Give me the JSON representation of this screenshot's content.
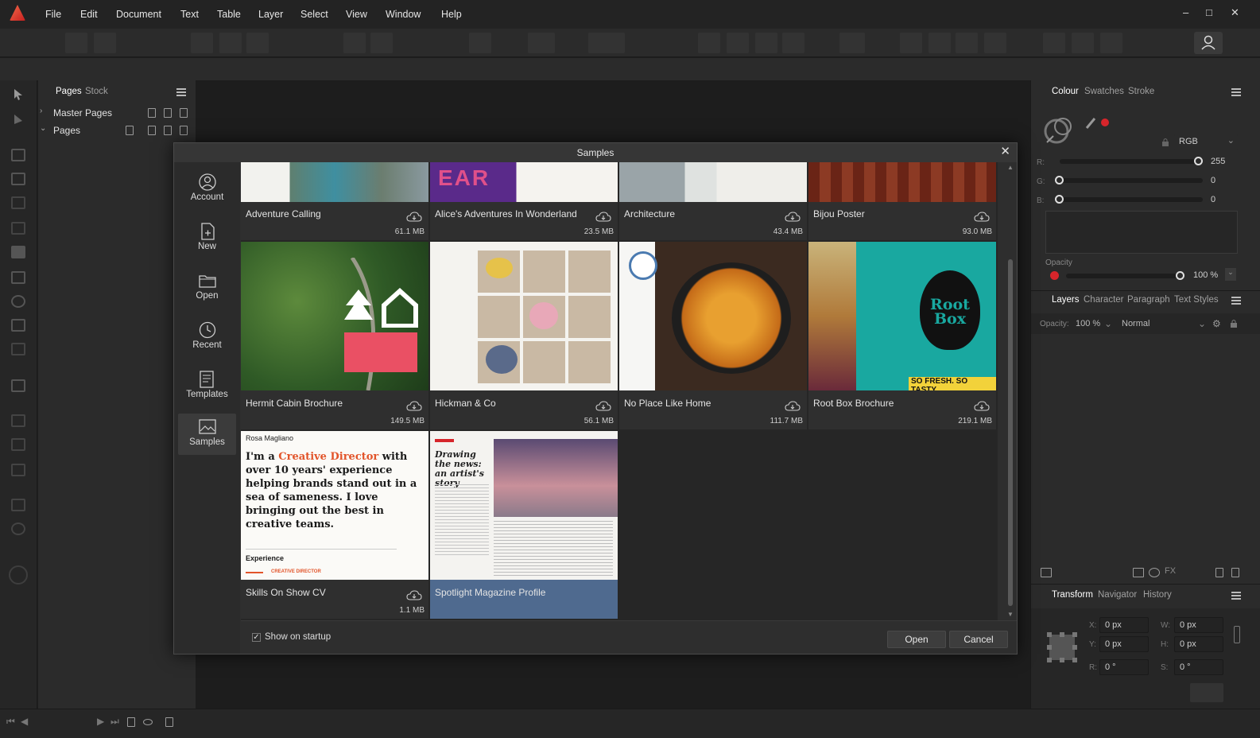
{
  "menu": {
    "items": [
      "File",
      "Edit",
      "Document",
      "Text",
      "Table",
      "Layer",
      "Select",
      "View",
      "Window",
      "Help"
    ]
  },
  "window_controls": {
    "minimize": "–",
    "maximize": "□",
    "close": "✕"
  },
  "pages_panel": {
    "tabs": [
      "Pages",
      "Stock"
    ],
    "rows": [
      "Master Pages",
      "Pages"
    ]
  },
  "right_panel": {
    "colour_tabs": [
      "Colour",
      "Swatches",
      "Stroke"
    ],
    "colour_model": "RGB",
    "channels": [
      {
        "label": "R:",
        "value": "255"
      },
      {
        "label": "G:",
        "value": "0"
      },
      {
        "label": "B:",
        "value": "0"
      }
    ],
    "opacity_label": "Opacity",
    "opacity_value": "100 %",
    "layers_tabs": [
      "Layers",
      "Character",
      "Paragraph",
      "Text Styles"
    ],
    "layers_opacity_label": "Opacity:",
    "layers_opacity_value": "100 %",
    "blend_mode": "Normal",
    "transform_tabs": [
      "Transform",
      "Navigator",
      "History"
    ],
    "transform": {
      "x_label": "X:",
      "x_value": "0 px",
      "y_label": "Y:",
      "y_value": "0 px",
      "w_label": "W:",
      "w_value": "0 px",
      "h_label": "H:",
      "h_value": "0 px",
      "r_label": "R:",
      "r_value": "0 °",
      "s_label": "S:",
      "s_value": "0 °"
    }
  },
  "dialog": {
    "title": "Samples",
    "close": "✕",
    "sidebar": [
      "Account",
      "New",
      "Open",
      "Recent",
      "Templates",
      "Samples"
    ],
    "cards": [
      {
        "title": "Adventure Calling",
        "size": "61.1 MB"
      },
      {
        "title": "Alice's Adventures In Wonderland",
        "size": "23.5 MB"
      },
      {
        "title": "Architecture",
        "size": "43.4 MB"
      },
      {
        "title": "Bijou Poster",
        "size": "93.0 MB"
      },
      {
        "title": "Hermit Cabin Brochure",
        "size": "149.5 MB"
      },
      {
        "title": "Hickman & Co",
        "size": "56.1 MB"
      },
      {
        "title": "No Place Like Home",
        "size": "111.7 MB"
      },
      {
        "title": "Root Box Brochure",
        "size": "219.1 MB"
      },
      {
        "title": "Skills On Show CV",
        "size": "1.1 MB"
      },
      {
        "title": "Spotlight Magazine Profile",
        "size": ""
      }
    ],
    "cv_thumb": {
      "name": "Rosa Magliano",
      "line1_pre": "I'm a ",
      "line1_accent": "Creative Director",
      "line1_post": " with",
      "rest": "over 10 years' experience helping brands stand out in a sea of sameness. I love bringing out the best in creative teams.",
      "section": "Experience",
      "role": "CREATIVE DIRECTOR"
    },
    "magazine_thumb": {
      "headline": "Drawing the news: an artist's story"
    },
    "rootbox_thumb": {
      "logo": "Root Box",
      "tagline": "SO FRESH. SO TASTY."
    },
    "show_on_startup_label": "Show on startup",
    "show_on_startup_check": "✓",
    "open_button": "Open",
    "cancel_button": "Cancel"
  },
  "colors": {
    "accent_red": "#d6252b",
    "selection_blue": "#4f6a8f",
    "cv_orange": "#e2542a",
    "rootbox_teal": "#19a8a0"
  }
}
